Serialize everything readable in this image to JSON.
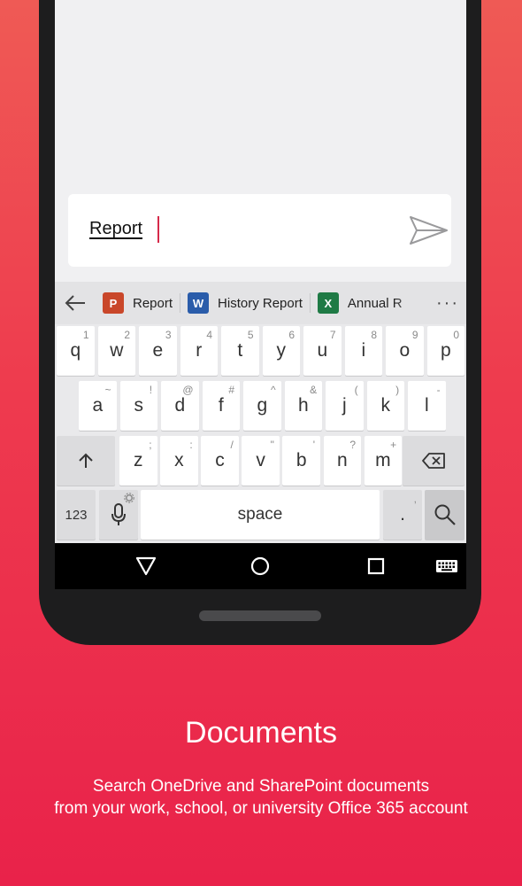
{
  "input": {
    "text": "Report"
  },
  "suggestions": [
    {
      "label": "Report",
      "app": "P",
      "color": "#c9472a"
    },
    {
      "label": "History Report",
      "app": "W",
      "color": "#2a5caa"
    },
    {
      "label": "Annual R",
      "app": "X",
      "color": "#1f7a45"
    }
  ],
  "more_label": "···",
  "keyboard": {
    "row1": [
      {
        "k": "q",
        "h": "1"
      },
      {
        "k": "w",
        "h": "2"
      },
      {
        "k": "e",
        "h": "3"
      },
      {
        "k": "r",
        "h": "4"
      },
      {
        "k": "t",
        "h": "5"
      },
      {
        "k": "y",
        "h": "6"
      },
      {
        "k": "u",
        "h": "7"
      },
      {
        "k": "i",
        "h": "8"
      },
      {
        "k": "o",
        "h": "9"
      },
      {
        "k": "p",
        "h": "0"
      }
    ],
    "row2": [
      {
        "k": "a",
        "h": "~"
      },
      {
        "k": "s",
        "h": "!"
      },
      {
        "k": "d",
        "h": "@"
      },
      {
        "k": "f",
        "h": "#"
      },
      {
        "k": "g",
        "h": "^"
      },
      {
        "k": "h",
        "h": "&"
      },
      {
        "k": "j",
        "h": "("
      },
      {
        "k": "k",
        "h": ")"
      },
      {
        "k": "l",
        "h": "-"
      }
    ],
    "row3": [
      {
        "k": "z",
        "h": ";"
      },
      {
        "k": "x",
        "h": ":"
      },
      {
        "k": "c",
        "h": "/"
      },
      {
        "k": "v",
        "h": "\""
      },
      {
        "k": "b",
        "h": "'"
      },
      {
        "k": "n",
        "h": "?"
      },
      {
        "k": "m",
        "h": "+"
      }
    ],
    "numbers_label": "123",
    "space_label": "space",
    "period_label": ".",
    "period_hint": ","
  },
  "headline": "Documents",
  "subtitle": [
    "Search OneDrive and SharePoint documents",
    "from your work, school, or university Office 365 account"
  ]
}
